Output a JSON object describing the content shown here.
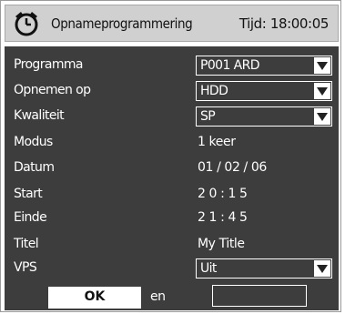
{
  "header": {
    "title": "Opnameprogrammering",
    "time": "Tijd: 18:00:05",
    "icon": "timer-clock-icon"
  },
  "form": {
    "programma": {
      "label": "Programma",
      "value": "P001 ARD"
    },
    "opnemen_op": {
      "label": "Opnemen op",
      "value": "HDD"
    },
    "kwaliteit": {
      "label": "Kwaliteit",
      "value": "SP"
    },
    "modus": {
      "label": "Modus",
      "value": "1 keer"
    },
    "datum": {
      "label": "Datum",
      "value": "01 / 02 / 06"
    },
    "start": {
      "label": "Start",
      "value": "2 0 : 1 5"
    },
    "einde": {
      "label": "Einde",
      "value": "2 1 : 4 5"
    },
    "titel": {
      "label": "Titel",
      "value": "My Title"
    },
    "vps": {
      "label": "VPS",
      "value": "Uit"
    }
  },
  "buttons": {
    "ok": "OK",
    "second_partial": "en"
  },
  "colors": {
    "panel_bg": "#3d3d3d",
    "titlebar_bg": "#d0d0d0",
    "text": "#ffffff"
  }
}
